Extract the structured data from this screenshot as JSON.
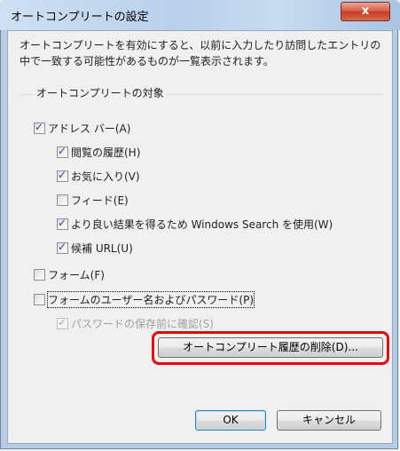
{
  "window": {
    "title": "オートコンプリートの設定",
    "close_glyph": "x"
  },
  "description": "オートコンプリートを有効にすると、以前に入力したり訪問したエントリの中で一致する可能性があるものが一覧表示されます。",
  "group": {
    "label": "オートコンプリートの対象"
  },
  "options": {
    "address_bar": {
      "label": "アドレス バー(A)",
      "checked": true
    },
    "history": {
      "label": "閲覧の履歴(H)",
      "checked": true
    },
    "favorites": {
      "label": "お気に入り(V)",
      "checked": true
    },
    "feeds": {
      "label": "フィード(E)",
      "checked": false
    },
    "windows_search": {
      "label": "より良い結果を得るため Windows Search を使用(W)",
      "checked": true
    },
    "suggest_url": {
      "label": "候補 URL(U)",
      "checked": true
    },
    "forms": {
      "label": "フォーム(F)",
      "checked": false
    },
    "form_credentials": {
      "label": "フォームのユーザー名およびパスワード(P)",
      "checked": false
    },
    "ask_before_save": {
      "label": "パスワードの保存前に確認(S)",
      "checked": true,
      "disabled": true
    }
  },
  "buttons": {
    "delete_history": "オートコンプリート履歴の削除(D)...",
    "ok": "OK",
    "cancel": "キャンセル"
  },
  "highlight_color": "#e60012"
}
